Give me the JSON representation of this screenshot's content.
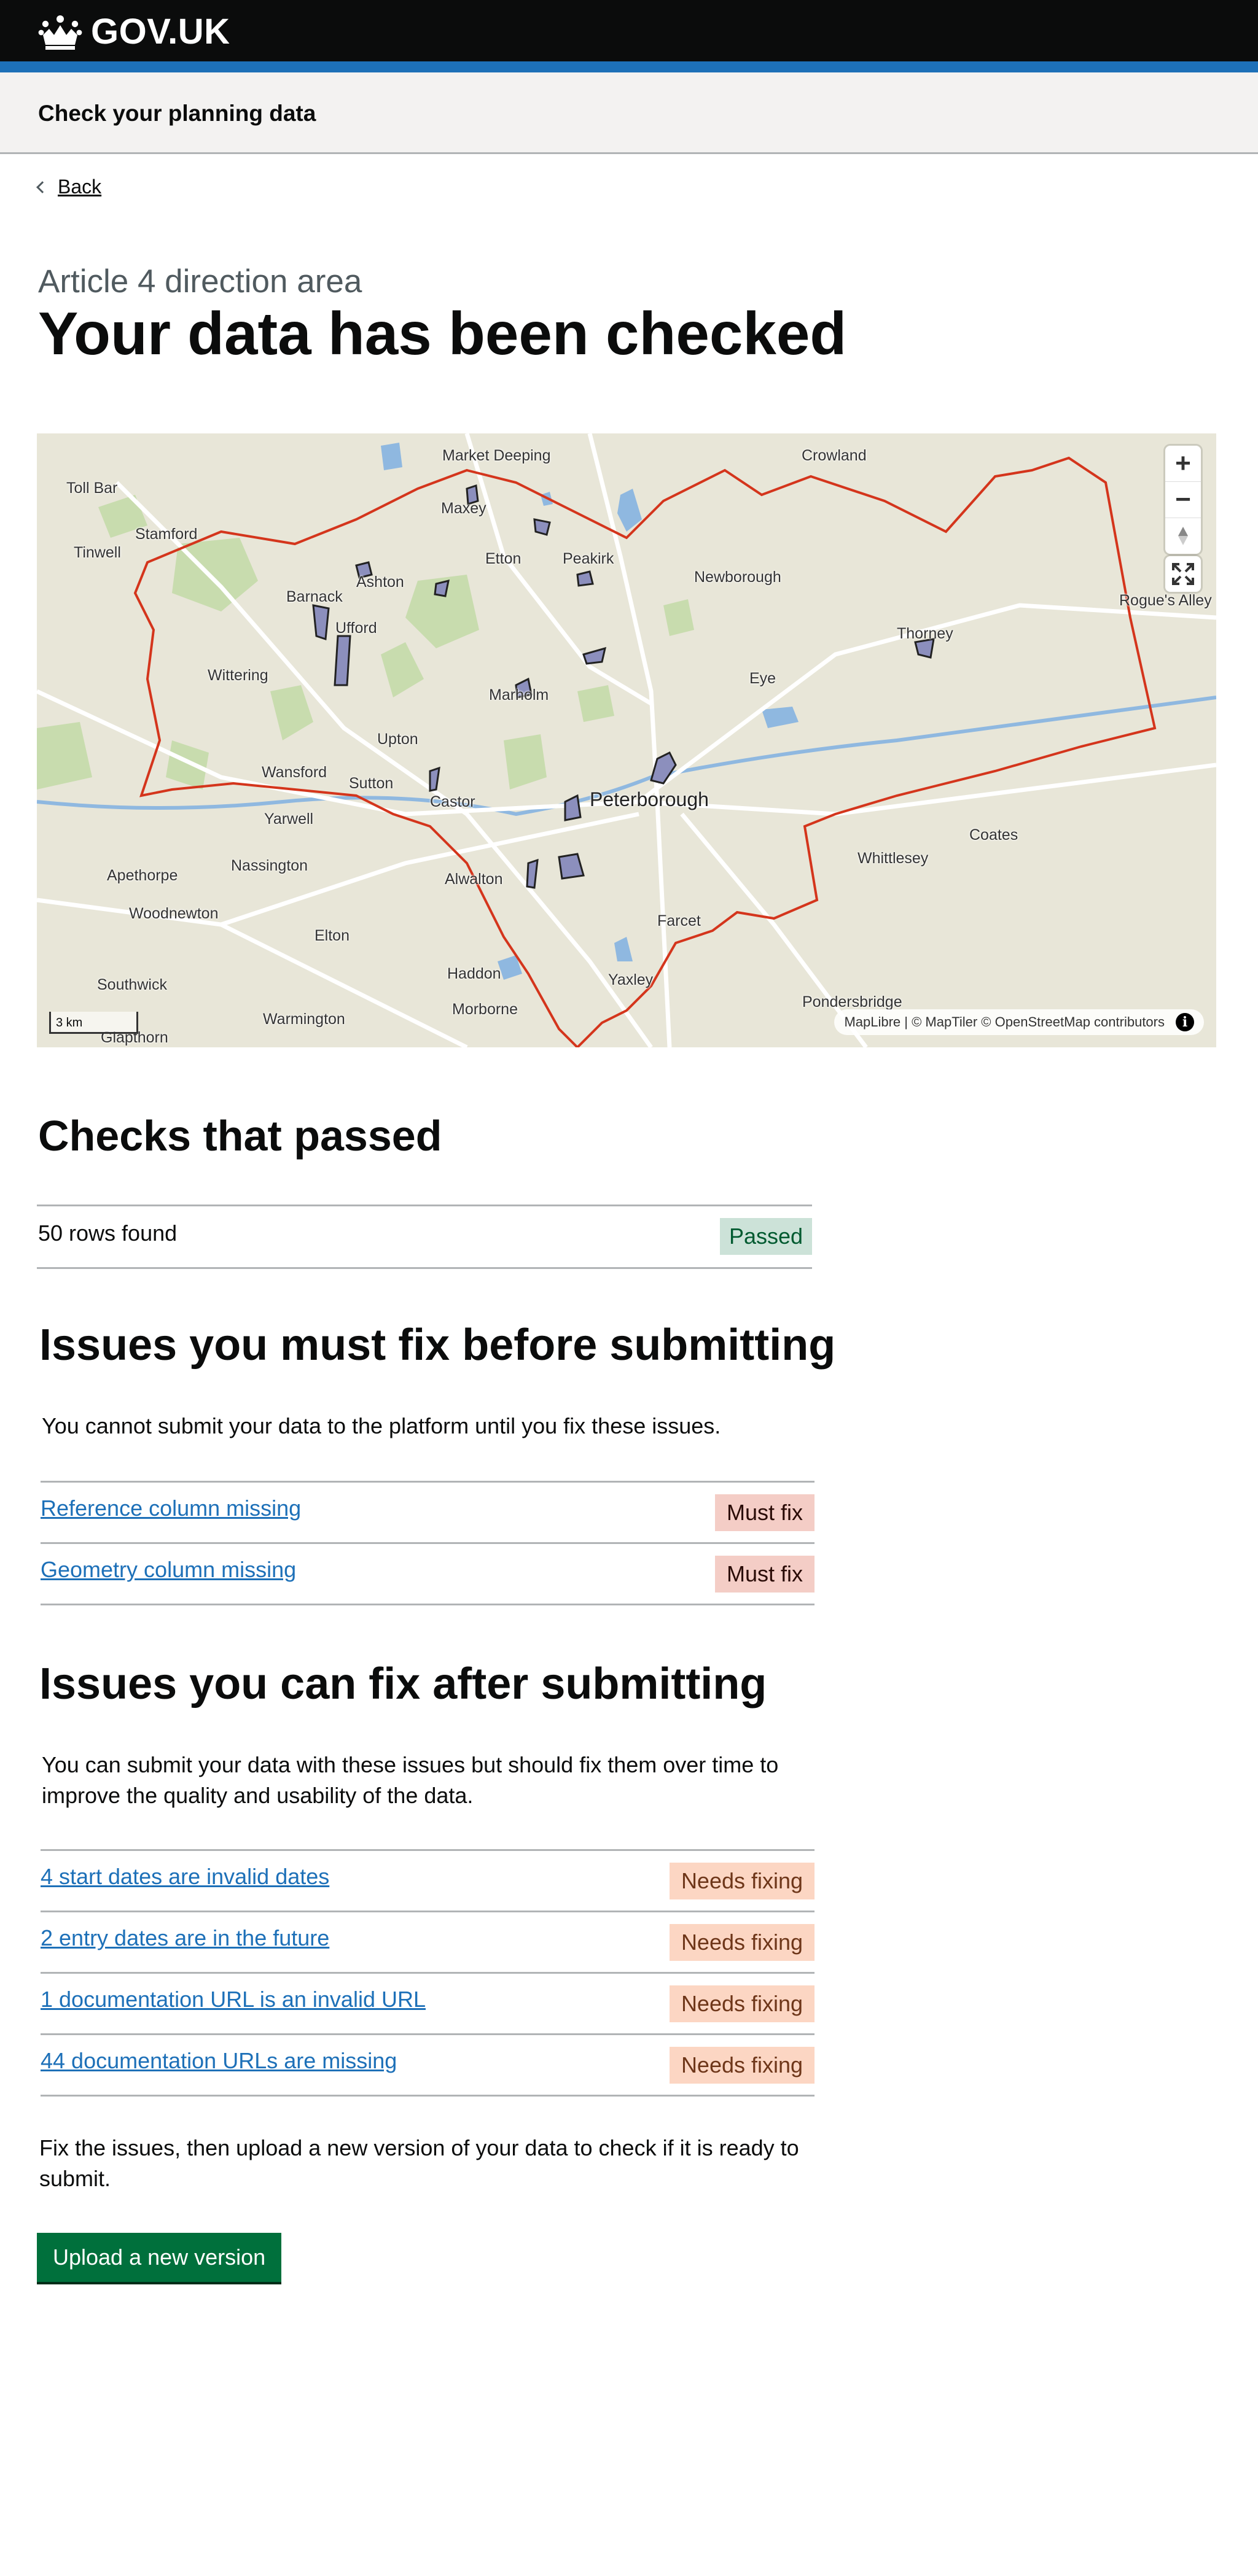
{
  "header": {
    "logo_text": "GOV.UK",
    "service_name": "Check your planning data"
  },
  "back_link": "Back",
  "caption": "Article 4 direction area",
  "title": "Your data has been checked",
  "map": {
    "attribution": "MapLibre | © MapTiler © OpenStreetMap contributors",
    "scale_label": "3 km",
    "zoom_in": "+",
    "zoom_out": "−",
    "place_labels": [
      "Market Deeping",
      "Crowland",
      "Toll Bar",
      "Maxey",
      "Stamford",
      "Tinwell",
      "Etton",
      "Peakirk",
      "Newborough",
      "Ashton",
      "Barnack",
      "Ufford",
      "Thorney",
      "Rogue's Alley",
      "Eye",
      "Wittering",
      "Marholm",
      "Upton",
      "Wansford",
      "Sutton",
      "Castor",
      "Peterborough",
      "Yarwell",
      "Coates",
      "Whittlesey",
      "Nassington",
      "Apethorpe",
      "Alwalton",
      "Woodnewton",
      "Farcet",
      "Elton",
      "Yaxley",
      "Southwick",
      "Haddon",
      "Morborne",
      "Warmington",
      "Pondersbridge",
      "Glapthorn"
    ]
  },
  "checks_passed": {
    "heading": "Checks that passed",
    "rows": [
      {
        "text": "50 rows found",
        "tag": "Passed"
      }
    ]
  },
  "must_fix": {
    "heading": "Issues you must fix before submitting",
    "intro": "You cannot submit your data to the platform until you fix these issues.",
    "rows": [
      {
        "text": "Reference column missing",
        "tag": "Must fix"
      },
      {
        "text": "Geometry column missing",
        "tag": "Must fix"
      }
    ]
  },
  "can_fix": {
    "heading": "Issues you can fix after submitting",
    "intro": "You can submit your data with these issues but should fix them over time to improve the quality and usability of the data.",
    "rows": [
      {
        "text": "4 start dates are invalid dates",
        "tag": "Needs fixing"
      },
      {
        "text": "2 entry dates are in the future",
        "tag": "Needs fixing"
      },
      {
        "text": "1 documentation URL is an invalid URL",
        "tag": "Needs fixing"
      },
      {
        "text": "44 documentation URLs are missing",
        "tag": "Needs fixing"
      }
    ]
  },
  "footer_text": "Fix the issues, then upload a new version of your data to check if it is ready to submit.",
  "upload_button": "Upload a new version",
  "colors": {
    "header": "#0b0c0c",
    "brand_blue": "#1d70b8",
    "link": "#1d70b8",
    "button": "#00703c",
    "boundary": "#d4351c"
  }
}
